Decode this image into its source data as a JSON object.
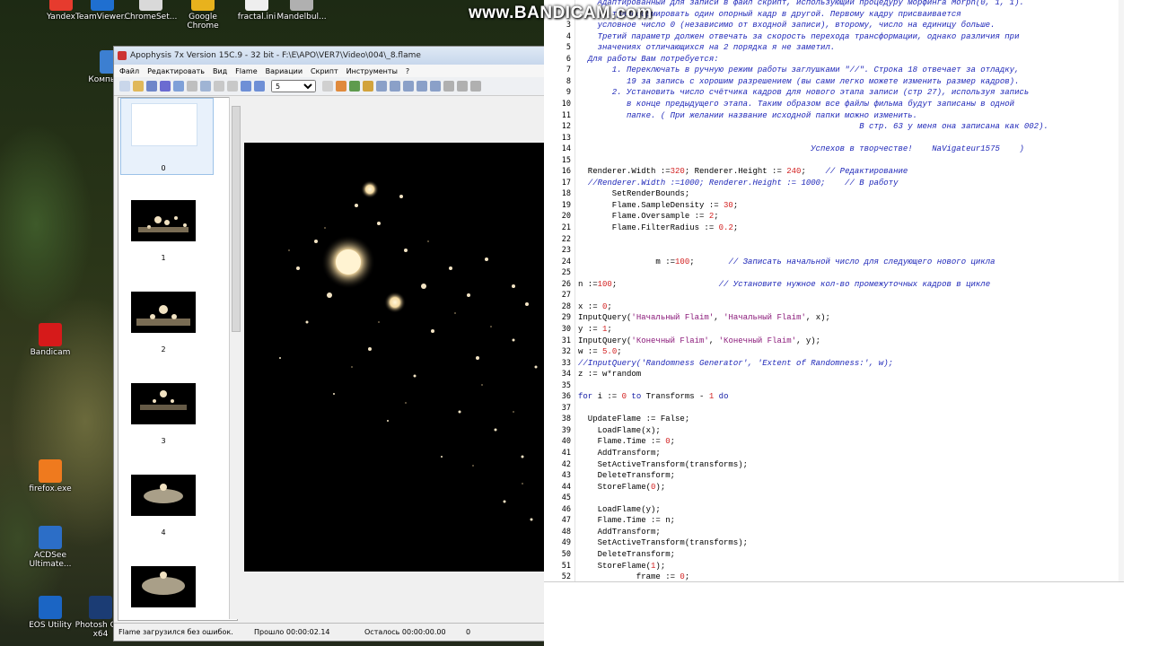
{
  "watermark": "www.BANDICAM.com",
  "desktop_icons": [
    {
      "label": "Yandex",
      "color": "#e63b2e"
    },
    {
      "label": "TeamViewer...",
      "color": "#1f6fd0"
    },
    {
      "label": "ChromeSet...",
      "color": "#d9d9d9"
    },
    {
      "label": "Google Chrome",
      "color": "#e8b21d"
    },
    {
      "label": "fractal.ini",
      "color": "#eeeeee"
    },
    {
      "label": "Mandelbul...",
      "color": "#b0b0b0"
    },
    {
      "label": "Компьют...",
      "color": "#3c7fd1"
    },
    {
      "label": "Bandicam",
      "color": "#d61a1a"
    },
    {
      "label": "firefox.exe",
      "color": "#ef7a1e"
    },
    {
      "label": "ACDSee Ultimate...",
      "color": "#2c6ec7"
    },
    {
      "label": "EOS Utility",
      "color": "#1b65c4"
    },
    {
      "label": "Photosh CS6 x64",
      "color": "#1b3c74"
    }
  ],
  "apophysis": {
    "title": "Apophysis 7x Version 15C.9  - 32 bit - F:\\E\\APO\\VER7\\Video\\004\\_8.flame",
    "menu": [
      "Файл",
      "Редактировать",
      "Вид",
      "Flame",
      "Вариации",
      "Скрипт",
      "Инструменты",
      "?"
    ],
    "toolbar_select_value": "5",
    "thumb_labels": [
      "0",
      "1",
      "2",
      "3",
      "4"
    ],
    "status": {
      "message": "Flame загрузился без ошибок.",
      "elapsed": "Прошло 00:00:02.14",
      "remaining": "Осталось 00:00:00.00",
      "count": "0"
    }
  },
  "editor": {
    "lines": [
      {
        "n": "",
        "html": "<span class=\"cm\">    Адаптированный для записи в файл скрипт, использующий процедуру морфинга Morph(0, 1, 1).</span>",
        "indent": 0
      },
      {
        "n": "",
        "html": "<span class=\"cm\">    ...трансформировать один опорный кадр в другой. Первому кадру присваивается</span>",
        "indent": 0
      },
      {
        "n": "3",
        "html": "<span class=\"cm\">    условное число 0 (независимо от входной записи), второму, число на единицу больше.</span>",
        "indent": 0
      },
      {
        "n": "4",
        "html": "<span class=\"cm\">    Третий параметр должен отвечать за скорость перехода трансформации, однако различия при</span>",
        "indent": 0
      },
      {
        "n": "5",
        "html": "<span class=\"cm\">    значениях отличающихся на 2 порядка я не заметил.</span>",
        "indent": 0
      },
      {
        "n": "6",
        "html": "<span class=\"cm\">  Для работы Вам потребуется:</span>",
        "indent": 0
      },
      {
        "n": "7",
        "html": "<span class=\"cm\">       1. Переключать в ручную режим работы заглушками \"//\". Строка 18 отвечает за отладку,</span>",
        "indent": 0
      },
      {
        "n": "8",
        "html": "<span class=\"cm\">          19 за запись с хорошим разрешением (вы сами легко можете изменить размер кадров).</span>",
        "indent": 0
      },
      {
        "n": "9",
        "html": "<span class=\"cm\">       2. Установить число счётчика кадров для нового этапа записи (стр 27), используя запись</span>",
        "indent": 0
      },
      {
        "n": "10",
        "html": "<span class=\"cm\">          в конце предыдущего этапа. Таким образом все файлы фильма будут записаны в одной</span>",
        "indent": 0
      },
      {
        "n": "11",
        "html": "<span class=\"cm\">          папке. ( При желании название исходной папки можно изменить.</span>",
        "indent": 0
      },
      {
        "n": "12",
        "html": "<span class=\"cm\">                                                          В стр. 63 у меня она записана как 002).</span>",
        "indent": 0
      },
      {
        "n": "13",
        "html": "",
        "indent": 0
      },
      {
        "n": "14",
        "html": "<span class=\"cm\">                                                Успехов в творчестве!    NaVigateur1575    )</span>",
        "indent": 0
      },
      {
        "n": "15",
        "html": "",
        "indent": 0
      },
      {
        "n": "16",
        "html": "  Renderer.Width :=<span class=\"num\">320</span>; Renderer.Height := <span class=\"num\">240</span>;    <span class=\"cm\">// Редактирование</span>",
        "indent": 0
      },
      {
        "n": "17",
        "html": "  <span class=\"cm\">//Renderer.Width :=1000; Renderer.Height := 1000;    // В работу</span>",
        "indent": 0
      },
      {
        "n": "18",
        "html": "       SetRenderBounds;",
        "indent": 0
      },
      {
        "n": "19",
        "html": "       Flame.SampleDensity := <span class=\"num\">30</span>;",
        "indent": 0
      },
      {
        "n": "20",
        "html": "       Flame.Oversample := <span class=\"num\">2</span>;",
        "indent": 0
      },
      {
        "n": "21",
        "html": "       Flame.FilterRadius := <span class=\"num\">0.2</span>;",
        "indent": 0
      },
      {
        "n": "22",
        "html": "",
        "indent": 0
      },
      {
        "n": "23",
        "html": "",
        "indent": 0
      },
      {
        "n": "24",
        "html": "                m :=<span class=\"num\">100</span>;       <span class=\"cm\">// Записать начальной число для следующего нового цикла</span>",
        "indent": 0
      },
      {
        "n": "25",
        "html": "",
        "indent": 0
      },
      {
        "n": "26",
        "html": "n :=<span class=\"num\">100</span>;                     <span class=\"cm\">// Установите нужное кол-во промежуточных кадров в цикле</span>",
        "indent": 0
      },
      {
        "n": "27",
        "html": "",
        "indent": 0
      },
      {
        "n": "28",
        "html": "x := <span class=\"num\">0</span>;",
        "indent": 0
      },
      {
        "n": "29",
        "html": "InputQuery(<span class=\"str\">'Начальный Flaim'</span>, <span class=\"str\">'Начальный Flaim'</span>, x);",
        "indent": 0
      },
      {
        "n": "30",
        "html": "y := <span class=\"num\">1</span>;",
        "indent": 0
      },
      {
        "n": "31",
        "html": "InputQuery(<span class=\"str\">'Конечный Flaim'</span>, <span class=\"str\">'Конечный Flaim'</span>, y);",
        "indent": 0
      },
      {
        "n": "32",
        "html": "w := <span class=\"num\">5.0</span>;",
        "indent": 0
      },
      {
        "n": "33",
        "html": "<span class=\"cm\">//InputQuery('Randomness Generator', 'Extent of Randomness:', w);</span>",
        "indent": 0
      },
      {
        "n": "34",
        "html": "z := w*random",
        "indent": 0
      },
      {
        "n": "35",
        "html": "",
        "indent": 0
      },
      {
        "n": "36",
        "html": "<span class=\"kw\">for</span> i := <span class=\"num\">0</span> <span class=\"kw\">to</span> Transforms - <span class=\"num\">1</span> <span class=\"kw\">do</span>",
        "indent": 0
      },
      {
        "n": "37",
        "html": "",
        "indent": 0
      },
      {
        "n": "38",
        "html": "  UpdateFlame := False;",
        "indent": 0
      },
      {
        "n": "39",
        "html": "    LoadFlame(x);",
        "indent": 0
      },
      {
        "n": "40",
        "html": "    Flame.Time := <span class=\"num\">0</span>;",
        "indent": 0
      },
      {
        "n": "41",
        "html": "    AddTransform;",
        "indent": 0
      },
      {
        "n": "42",
        "html": "    SetActiveTransform(transforms);",
        "indent": 0
      },
      {
        "n": "43",
        "html": "    DeleteTransform;",
        "indent": 0
      },
      {
        "n": "44",
        "html": "    StoreFlame(<span class=\"num\">0</span>);",
        "indent": 0
      },
      {
        "n": "45",
        "html": "",
        "indent": 0
      },
      {
        "n": "46",
        "html": "    LoadFlame(y);",
        "indent": 0
      },
      {
        "n": "47",
        "html": "    Flame.Time := n;",
        "indent": 0
      },
      {
        "n": "48",
        "html": "    AddTransform;",
        "indent": 0
      },
      {
        "n": "49",
        "html": "    SetActiveTransform(transforms);",
        "indent": 0
      },
      {
        "n": "50",
        "html": "    DeleteTransform;",
        "indent": 0
      },
      {
        "n": "51",
        "html": "    StoreFlame(<span class=\"num\">1</span>);",
        "indent": 0
      },
      {
        "n": "52",
        "html": "            frame := <span class=\"num\">0</span>;",
        "indent": 0
      }
    ]
  }
}
